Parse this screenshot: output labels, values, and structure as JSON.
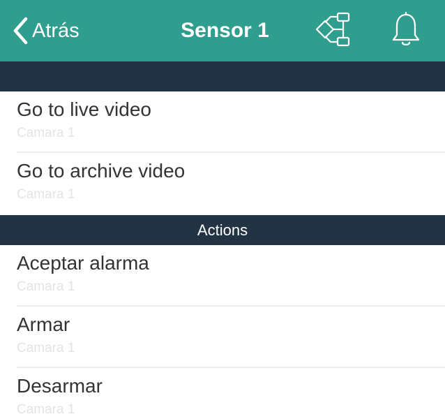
{
  "navbar": {
    "back_label": "Atrás",
    "title": "Sensor 1",
    "icons": [
      "back-chevron-icon",
      "hierarchy-icon",
      "bell-icon"
    ],
    "background_color": "#2f9e8e"
  },
  "sections": [
    {
      "header": "",
      "items": [
        {
          "title": "Go to live video",
          "subtitle": "Camara 1"
        },
        {
          "title": "Go to archive video",
          "subtitle": "Camara 1"
        }
      ]
    },
    {
      "header": "Actions",
      "items": [
        {
          "title": "Aceptar alarma",
          "subtitle": "Camara 1"
        },
        {
          "title": "Armar",
          "subtitle": "Camara 1"
        },
        {
          "title": "Desarmar",
          "subtitle": "Camara 1"
        }
      ]
    }
  ],
  "colors": {
    "section_header_bg": "#223443",
    "title_text": "#333333",
    "subtitle_text": "#e4e4e4"
  }
}
